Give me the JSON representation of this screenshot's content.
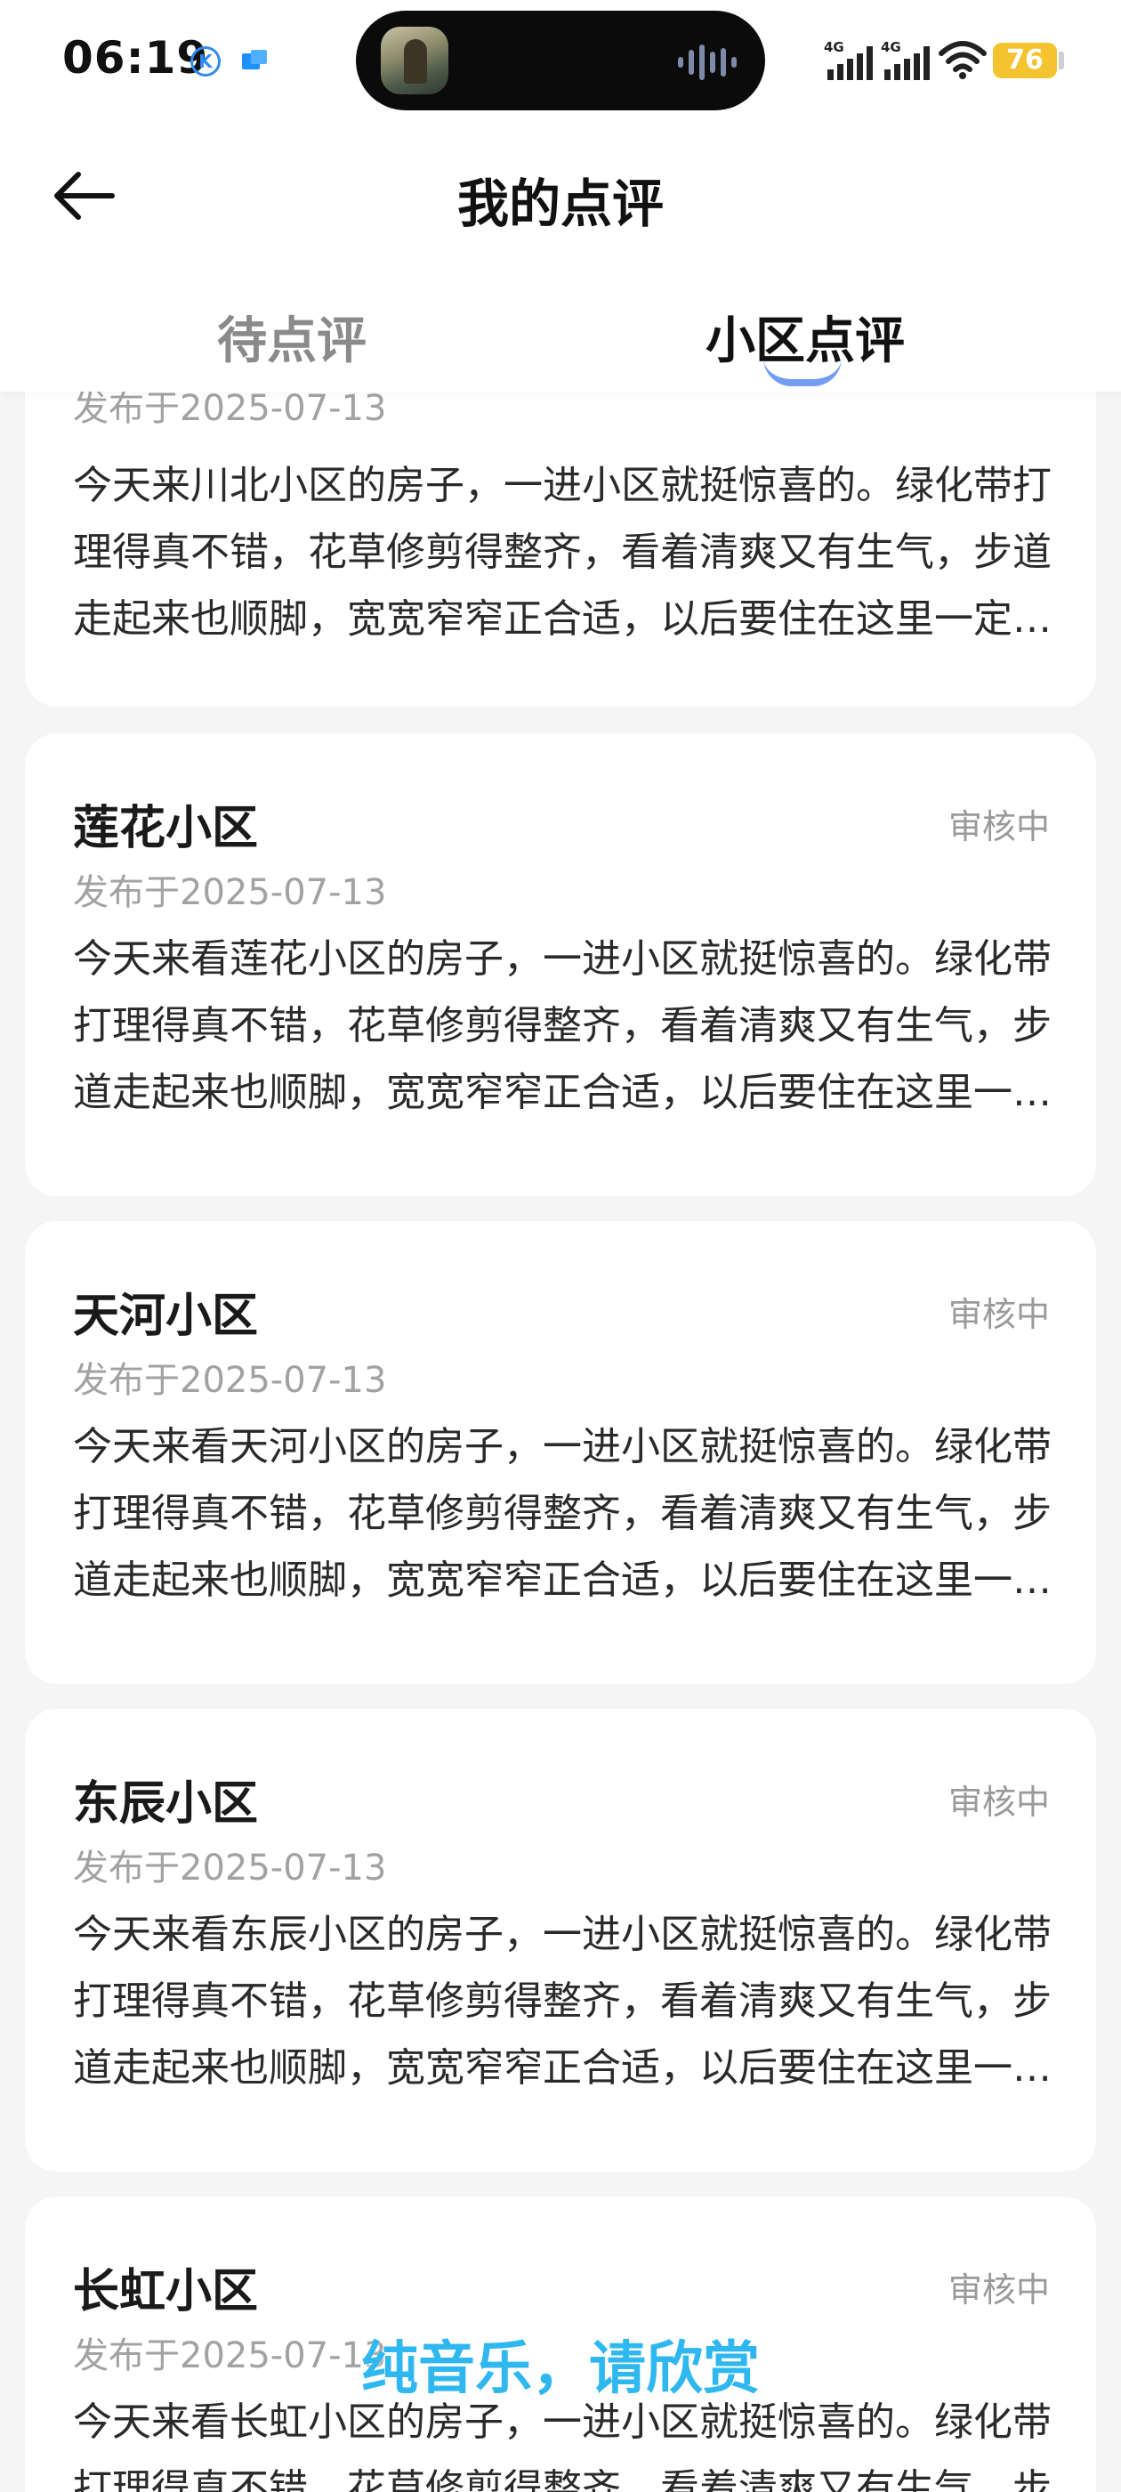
{
  "status_bar": {
    "time": "06:19",
    "notification_k": "K",
    "battery_level": "76",
    "signal_labels": [
      "4G",
      "4G"
    ],
    "colors": {
      "battery": "#f4c430",
      "notif_k": "#2f8cf0"
    }
  },
  "header": {
    "title": "我的点评",
    "tabs": [
      {
        "label": "待点评",
        "active": false
      },
      {
        "label": "小区点评",
        "active": true
      }
    ],
    "accent_color": "#5b8def"
  },
  "reviews": [
    {
      "name": "",
      "status": "",
      "date": "发布于2025-07-13",
      "text": "今天来川北小区的房子，一进小区就挺惊喜的。绿化带打理得真不错，花草修剪得整齐，看着清爽又有生气，步道走起来也顺脚，宽宽窄窄正合适，以后要住在这里一定很舒心。"
    },
    {
      "name": "莲花小区",
      "status": "审核中",
      "date": "发布于2025-07-13",
      "text": "今天来看莲花小区的房子，一进小区就挺惊喜的。绿化带打理得真不错，花草修剪得整齐，看着清爽又有生气，步道走起来也顺脚，宽宽窄窄正合适，以后要住在这里一定很舒心。"
    },
    {
      "name": "天河小区",
      "status": "审核中",
      "date": "发布于2025-07-13",
      "text": "今天来看天河小区的房子，一进小区就挺惊喜的。绿化带打理得真不错，花草修剪得整齐，看着清爽又有生气，步道走起来也顺脚，宽宽窄窄正合适，以后要住在这里一定很舒心。"
    },
    {
      "name": "东辰小区",
      "status": "审核中",
      "date": "发布于2025-07-13",
      "text": "今天来看东辰小区的房子，一进小区就挺惊喜的。绿化带打理得真不错，花草修剪得整齐，看着清爽又有生气，步道走起来也顺脚，宽宽窄窄正合适，以后要住在这里一定很舒心。"
    },
    {
      "name": "长虹小区",
      "status": "审核中",
      "date": "发布于2025-07-13",
      "text": "今天来看长虹小区的房子，一进小区就挺惊喜的。绿化带打理得真不错，花草修剪得整齐，看着清爽又有生气，步道走起来也顺脚，宽宽窄窄正合适，以后要住在这里一定很舒心。"
    }
  ],
  "overlay_caption": "纯音乐，请欣赏",
  "caption_color": "#2fb8f0"
}
